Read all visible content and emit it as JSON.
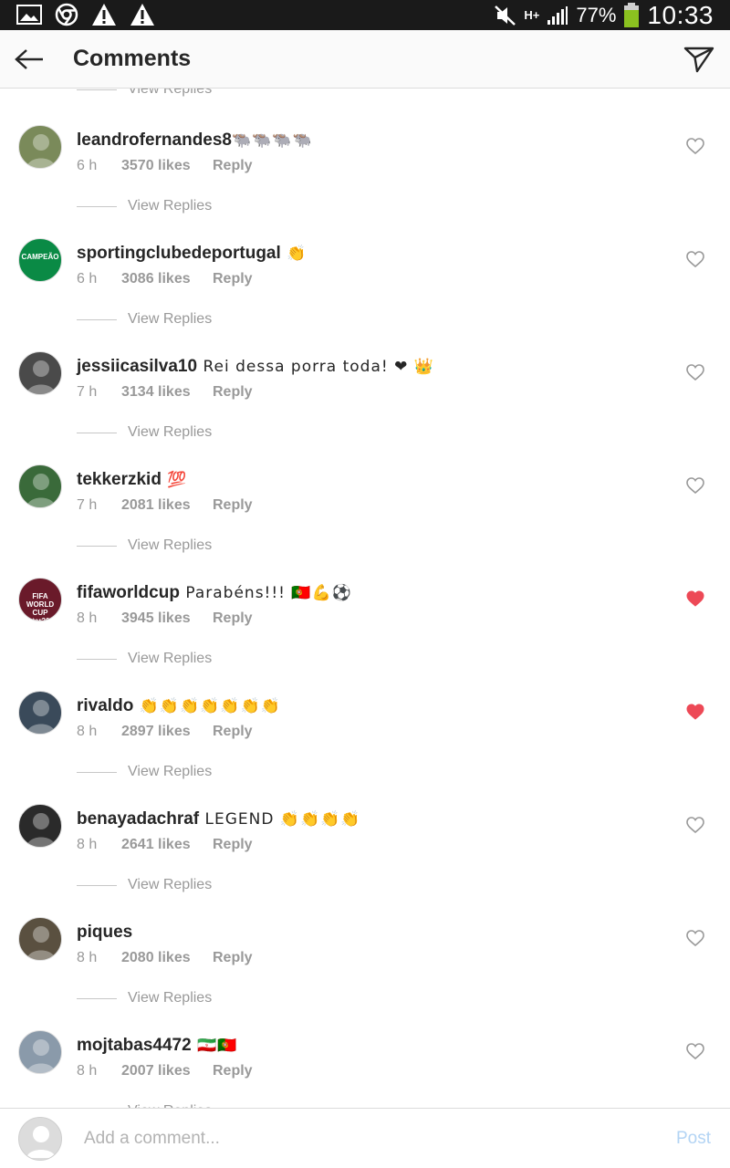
{
  "status_bar": {
    "battery": "77%",
    "time": "10:33",
    "network": "H+"
  },
  "header": {
    "title": "Comments"
  },
  "top_partial_view_replies": "View Replies",
  "comments": [
    {
      "user": "leandrofernandes8",
      "text": "🐃🐃🐃🐃",
      "time": "6 h",
      "likes": "3570 likes",
      "reply": "Reply",
      "view_replies": "View Replies",
      "liked": false,
      "avatar_color": "#7a8a5a"
    },
    {
      "user": "sportingclubedeportugal",
      "text": "  👏",
      "time": "6 h",
      "likes": "3086 likes",
      "reply": "Reply",
      "view_replies": "View Replies",
      "liked": false,
      "avatar_color": "#0a8a45",
      "avatar_text": "CAMPEÃO"
    },
    {
      "user": "jessiicasilva10",
      "text": " Rei dessa porra toda! ❤  👑",
      "time": "7 h",
      "likes": "3134 likes",
      "reply": "Reply",
      "view_replies": "View Replies",
      "liked": false,
      "avatar_color": "#4a4a4a"
    },
    {
      "user": "tekkerzkid",
      "text": " 💯",
      "time": "7 h",
      "likes": "2081 likes",
      "reply": "Reply",
      "view_replies": "View Replies",
      "liked": false,
      "avatar_color": "#3a6a3a"
    },
    {
      "user": "fifaworldcup",
      "text": " Parabéns!!! 🇵🇹💪⚽",
      "time": "8 h",
      "likes": "3945 likes",
      "reply": "Reply",
      "view_replies": "View Replies",
      "liked": true,
      "avatar_color": "#6a1a2a",
      "avatar_text": "FIFA WORLD CUP Qatar2022"
    },
    {
      "user": "rivaldo",
      "text": " 👏👏👏👏👏👏👏",
      "time": "8 h",
      "likes": "2897 likes",
      "reply": "Reply",
      "view_replies": "View Replies",
      "liked": true,
      "avatar_color": "#3a4a5a"
    },
    {
      "user": "benayadachraf",
      "text": " LEGEND 👏👏👏👏",
      "time": "8 h",
      "likes": "2641 likes",
      "reply": "Reply",
      "view_replies": "View Replies",
      "liked": false,
      "avatar_color": "#2a2a2a"
    },
    {
      "user": "piques",
      "text": "",
      "time": "8 h",
      "likes": "2080 likes",
      "reply": "Reply",
      "view_replies": "View Replies",
      "liked": false,
      "avatar_color": "#5a5040"
    },
    {
      "user": "mojtabas4472",
      "text": " 🇮🇷🇵🇹",
      "time": "8 h",
      "likes": "2007 likes",
      "reply": "Reply",
      "view_replies": "View Replies",
      "liked": false,
      "avatar_color": "#8a9aaa"
    }
  ],
  "composer": {
    "placeholder": "Add a comment...",
    "post_label": "Post"
  },
  "colors": {
    "heart_liked": "#ed4956",
    "heart_unliked": "#999999",
    "post_disabled": "#b3d4f4"
  }
}
